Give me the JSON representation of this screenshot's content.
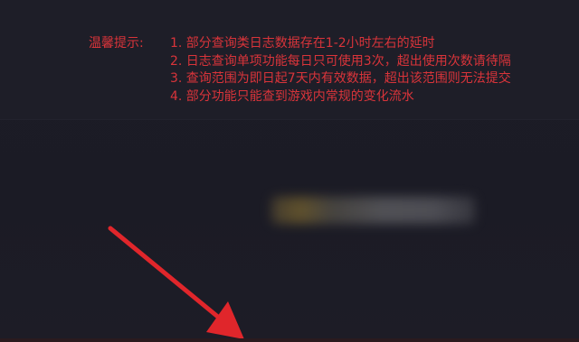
{
  "notice": {
    "label": "温馨提示:",
    "items": [
      "1. 部分查询类日志数据存在1-2小时左右的延时",
      "2. 日志查询单项功能每日只可使用3次，超出使用次数请待隔",
      "3. 查询范围为即日起7天内有效数据，超出该范围则无法提交",
      "4. 部分功能只能查到游戏内常规的变化流水"
    ]
  },
  "colors": {
    "background": "#1b1b25",
    "notice_text": "#d9343a",
    "arrow": "#e0262b"
  },
  "icons": {
    "pointer": "arrow-pointer-icon"
  }
}
